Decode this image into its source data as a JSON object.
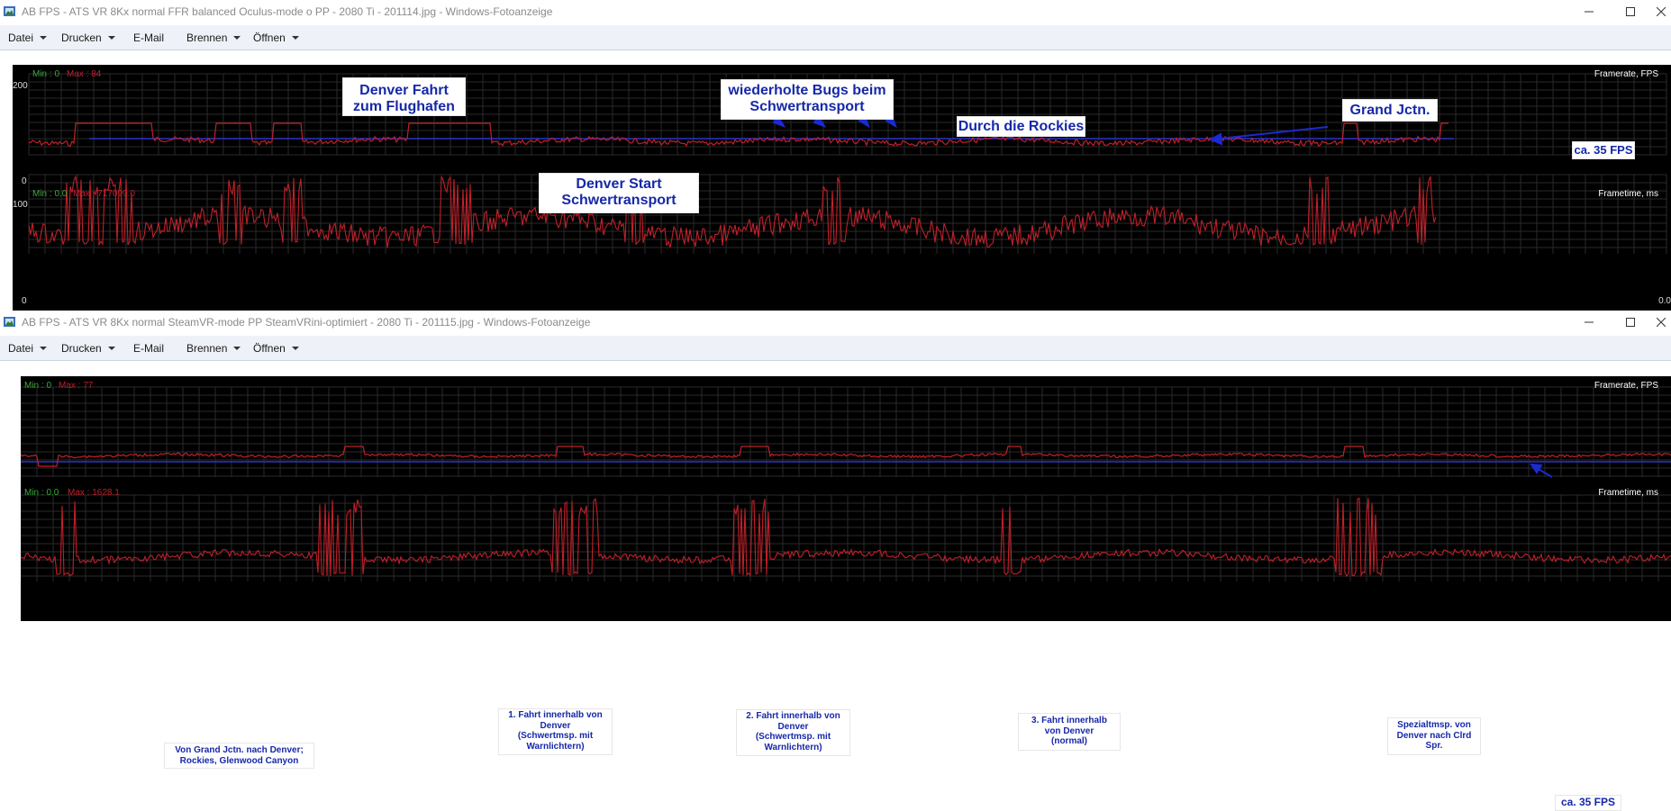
{
  "windows": [
    {
      "title": "AB FPS - ATS VR 8Kx normal FFR balanced Oculus-mode o PP - 2080 Ti - 201114.jpg - Windows-Fotoanzeige",
      "menu": [
        "Datei",
        "Drucken",
        "E-Mail",
        "Brennen",
        "Öffnen"
      ],
      "fps_graph": {
        "min_label": "Min : 0",
        "max_label": "Max : 84",
        "name": "Framerate, FPS",
        "y_top": "200",
        "y_bottom": "0"
      },
      "ft_graph": {
        "min_label": "Min : 0.0",
        "max_label": "Max : 717099.0",
        "name": "Frametime, ms",
        "y_top": "100",
        "y_bottom": "0",
        "right_value": "0.0"
      },
      "annotations": [
        {
          "id": "denver-fahrt",
          "lines": [
            "Denver Fahrt",
            "zum Flughafen"
          ]
        },
        {
          "id": "bugs",
          "lines": [
            "wiederholte Bugs beim",
            "Schwertransport"
          ]
        },
        {
          "id": "rockies",
          "lines": [
            "Durch die Rockies"
          ]
        },
        {
          "id": "grand-jctn",
          "lines": [
            "Grand Jctn."
          ]
        },
        {
          "id": "fps35",
          "lines": [
            "ca. 35 FPS"
          ]
        },
        {
          "id": "denver-start",
          "lines": [
            "Denver Start",
            "Schwertransport"
          ]
        }
      ]
    },
    {
      "title": "AB FPS - ATS VR 8Kx normal SteamVR-mode PP SteamVRini-optimiert - 2080 Ti - 201115.jpg - Windows-Fotoanzeige",
      "menu": [
        "Datei",
        "Drucken",
        "E-Mail",
        "Brennen",
        "Öffnen"
      ],
      "fps_graph": {
        "min_label": "Min : 0",
        "max_label": "Max : 77",
        "name": "Framerate, FPS"
      },
      "ft_graph": {
        "min_label": "Min : 0.0",
        "max_label": "Max : 1628.1",
        "name": "Frametime, ms"
      },
      "annotations": [
        {
          "id": "grand-jctn-denver",
          "lines": [
            "Von Grand Jctn. nach Denver;",
            "Rockies, Glenwood Canyon"
          ]
        },
        {
          "id": "fahrt1",
          "lines": [
            "1. Fahrt innerhalb von",
            "Denver",
            "(Schwertmsp. mit",
            "Warnlichtern)"
          ]
        },
        {
          "id": "fahrt2",
          "lines": [
            "2. Fahrt innerhalb von",
            "Denver",
            "(Schwertmsp. mit",
            "Warnlichtern)"
          ]
        },
        {
          "id": "fahrt3",
          "lines": [
            "3. Fahrt innerhalb",
            "von Denver",
            "(normal)"
          ]
        },
        {
          "id": "spezial",
          "lines": [
            "Spezialtmsp. von",
            "Denver nach Clrd",
            "Spr."
          ]
        },
        {
          "id": "fps35b",
          "lines": [
            "ca. 35 FPS"
          ]
        }
      ]
    }
  ],
  "colors": {
    "fps_line": "#c0202a",
    "ref_line": "#2a34c8",
    "grid": "#2a2a2a",
    "callout_text": "#1628a8",
    "min_label": "#3aa63a",
    "max_label": "#c0202a"
  },
  "icons": {
    "app": "photo-viewer-icon",
    "minimize": "minimize-icon",
    "maximize": "maximize-icon",
    "close": "close-icon"
  }
}
